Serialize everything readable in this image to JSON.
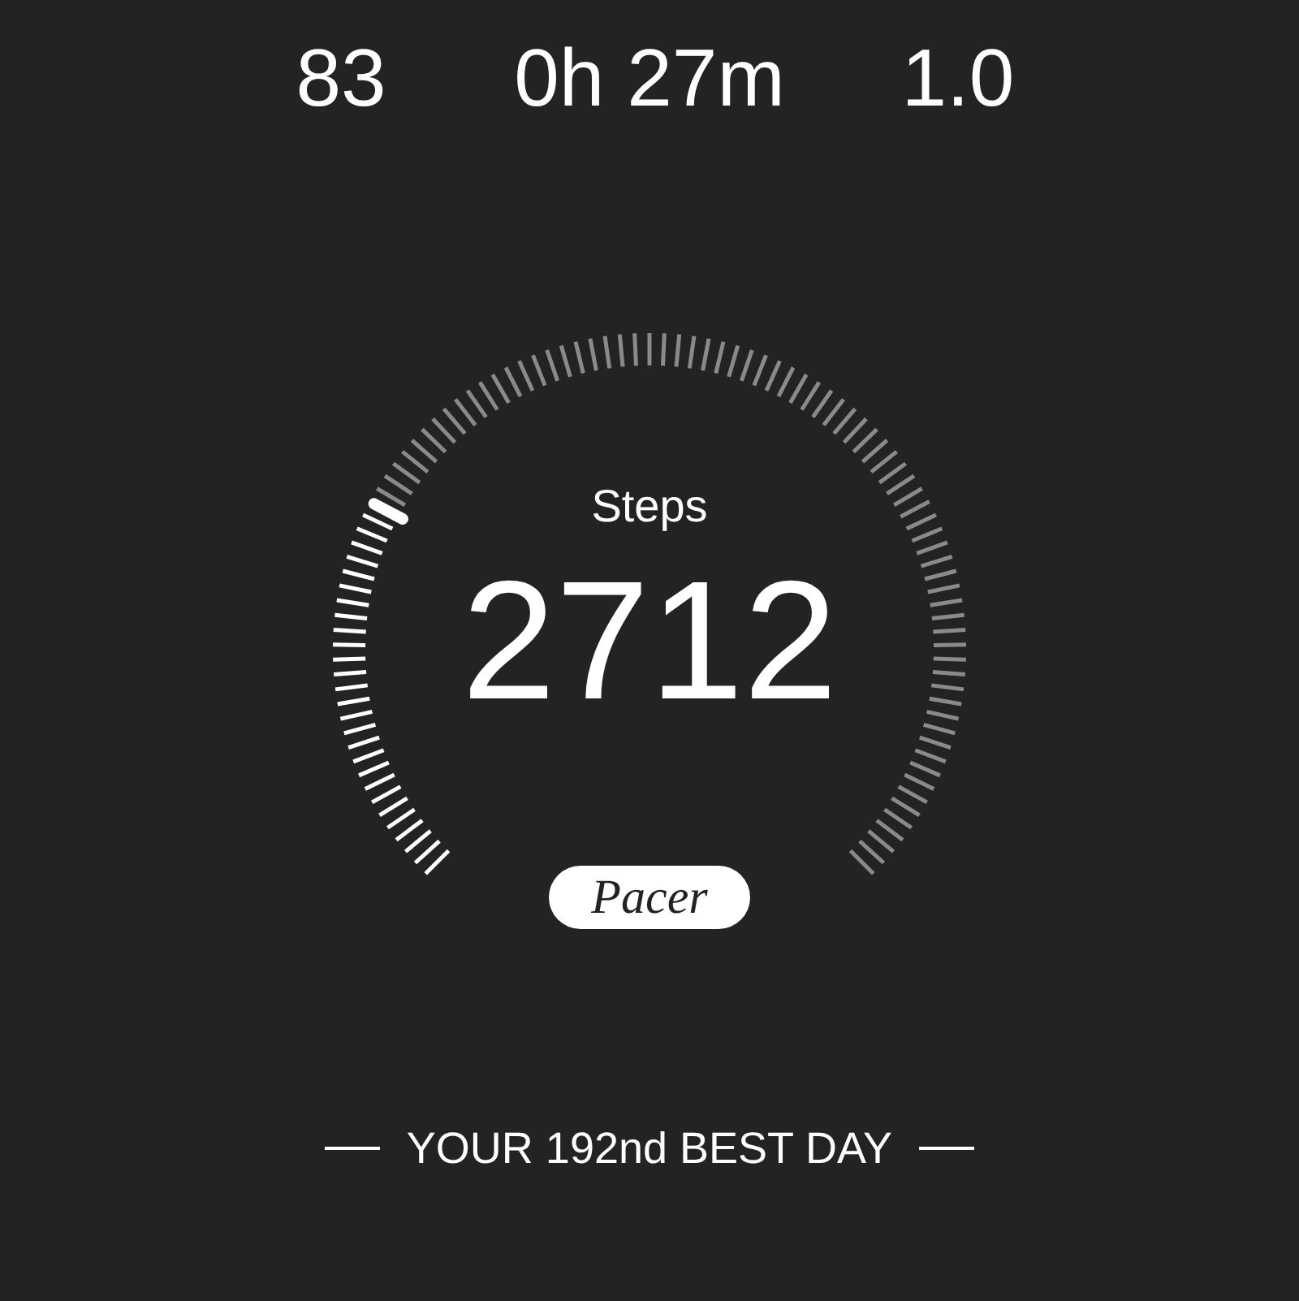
{
  "stats": [
    {
      "value": "83"
    },
    {
      "value": "0h 27m"
    },
    {
      "value": "1.0"
    }
  ],
  "steps": {
    "label": "Steps",
    "value": "2712"
  },
  "logo": "Pacer",
  "best_day": "YOUR 192nd BEST DAY"
}
